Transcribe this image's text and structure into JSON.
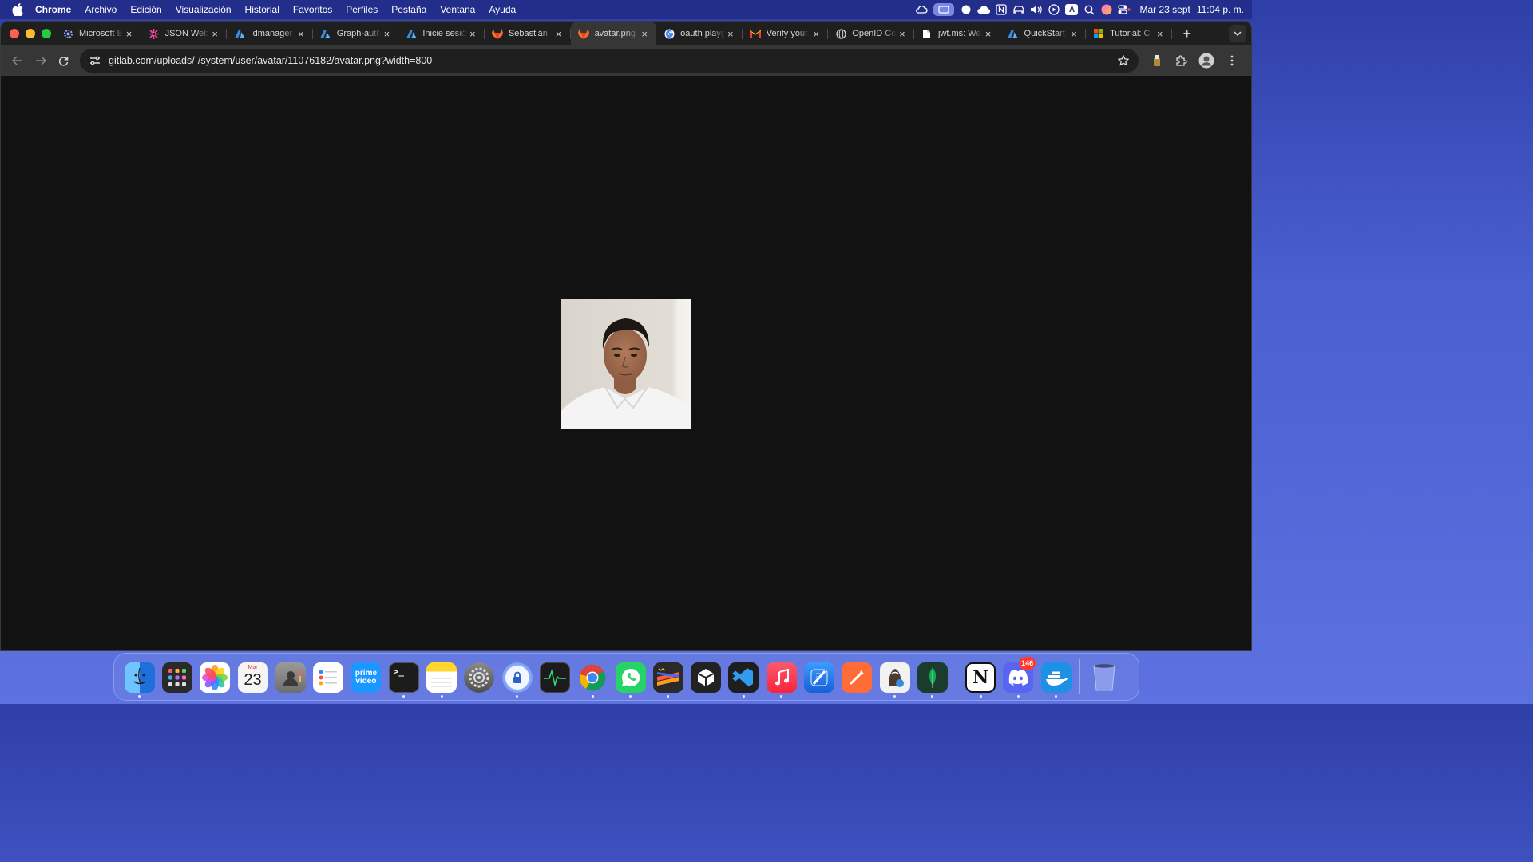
{
  "menubar": {
    "app_name": "Chrome",
    "items": [
      "Archivo",
      "Edición",
      "Visualización",
      "Historial",
      "Favoritos",
      "Perfiles",
      "Pestaña",
      "Ventana",
      "Ayuda"
    ],
    "date": "Mar 23 sept",
    "time": "11:04 p. m.",
    "status_icons": [
      "cloud-sync-icon",
      "screen-mirroring-icon",
      "circle-icon",
      "icloud-icon",
      "notion-icon",
      "car-icon",
      "volume-icon",
      "play-icon",
      "input-source-icon",
      "search-icon",
      "siri-icon",
      "control-center-icon"
    ],
    "input_source_label": "A"
  },
  "browser": {
    "tabs": [
      {
        "title": "Microsoft Entra",
        "icon": "gear-favicon-icon",
        "active": false
      },
      {
        "title": "JSON Web Tokens",
        "icon": "jwt-favicon-icon",
        "active": false
      },
      {
        "title": "idmanager",
        "icon": "azure-favicon-icon",
        "active": false
      },
      {
        "title": "Graph-auth",
        "icon": "azure-favicon-icon",
        "active": false
      },
      {
        "title": "Inicie sesión",
        "icon": "azure-favicon-icon",
        "active": false
      },
      {
        "title": "Sebastián",
        "icon": "gitlab-favicon-icon",
        "active": false
      },
      {
        "title": "avatar.png",
        "icon": "gitlab-favicon-icon",
        "active": true
      },
      {
        "title": "oauth playground",
        "icon": "google-favicon-icon",
        "active": false
      },
      {
        "title": "Verify your",
        "icon": "gmail-favicon-icon",
        "active": false
      },
      {
        "title": "OpenID Connect",
        "icon": "globe-favicon-icon",
        "active": false
      },
      {
        "title": "jwt.ms: Welcome",
        "icon": "document-favicon-icon",
        "active": false
      },
      {
        "title": "QuickStart",
        "icon": "azure-favicon-icon",
        "active": false
      },
      {
        "title": "Tutorial: C",
        "icon": "microsoft-favicon-icon",
        "active": false
      }
    ],
    "address": "gitlab.com/uploads/-/system/user/avatar/11076182/avatar.png?width=800",
    "image_alt": "avatar.png"
  },
  "dock": {
    "apps": [
      {
        "name": "finder",
        "label": "",
        "bg": "#1e88e5",
        "running": true
      },
      {
        "name": "launchpad",
        "label": "",
        "bg": "#2a2a2a",
        "running": false
      },
      {
        "name": "photos",
        "label": "",
        "bg": "#ffffff",
        "running": false
      },
      {
        "name": "calendar",
        "label": "23",
        "month": "Mar",
        "bg": "#f5f5f5",
        "running": false
      },
      {
        "name": "contacts",
        "label": "",
        "bg": "#8c8c8c",
        "running": false
      },
      {
        "name": "reminders",
        "label": "",
        "bg": "#ffffff",
        "running": false
      },
      {
        "name": "prime-video",
        "label": "prime video",
        "bg": "#1a98ff",
        "running": false
      },
      {
        "name": "terminal",
        "label": ">_",
        "bg": "#1c1c1c",
        "running": true
      },
      {
        "name": "notes",
        "label": "",
        "bg": "#ffd52e",
        "running": true
      },
      {
        "name": "system-settings",
        "label": "",
        "bg": "#6e6e6e",
        "running": false
      },
      {
        "name": "privacy-app",
        "label": "",
        "bg": "#e8f0ff",
        "running": true
      },
      {
        "name": "activity-monitor",
        "label": "",
        "bg": "#1b1b1b",
        "running": false
      },
      {
        "name": "chrome",
        "label": "",
        "bg": "#ffffff",
        "running": true
      },
      {
        "name": "whatsapp",
        "label": "",
        "bg": "#25d366",
        "running": true
      },
      {
        "name": "sublime-text",
        "label": "",
        "bg": "#2a2a2a",
        "running": true
      },
      {
        "name": "unity",
        "label": "",
        "bg": "#222222",
        "running": false
      },
      {
        "name": "vscode",
        "label": "",
        "bg": "#1e1e1e",
        "running": true
      },
      {
        "name": "music",
        "label": "",
        "bg": "#fa2d48",
        "running": true
      },
      {
        "name": "xcode",
        "label": "",
        "bg": "#1a73e8",
        "running": false
      },
      {
        "name": "postman",
        "label": "",
        "bg": "#ff6c37",
        "running": false
      },
      {
        "name": "tableplus",
        "label": "",
        "bg": "#f2f2f2",
        "running": true
      },
      {
        "name": "mongodb-compass",
        "label": "",
        "bg": "#1b3b2e",
        "running": true
      },
      {
        "name": "notion",
        "label": "N",
        "bg": "#ffffff",
        "running": true
      },
      {
        "name": "discord",
        "label": "",
        "bg": "#5865f2",
        "running": true,
        "badge": "146"
      },
      {
        "name": "docker",
        "label": "",
        "bg": "#1d91e6",
        "running": true
      },
      {
        "name": "trash",
        "label": "",
        "bg": "transparent",
        "running": false
      }
    ]
  },
  "colors": {
    "menubar_bg": "#232e8a",
    "tabstrip_bg": "#1f1f1f",
    "toolbar_bg": "#363636",
    "content_bg": "#121212"
  }
}
